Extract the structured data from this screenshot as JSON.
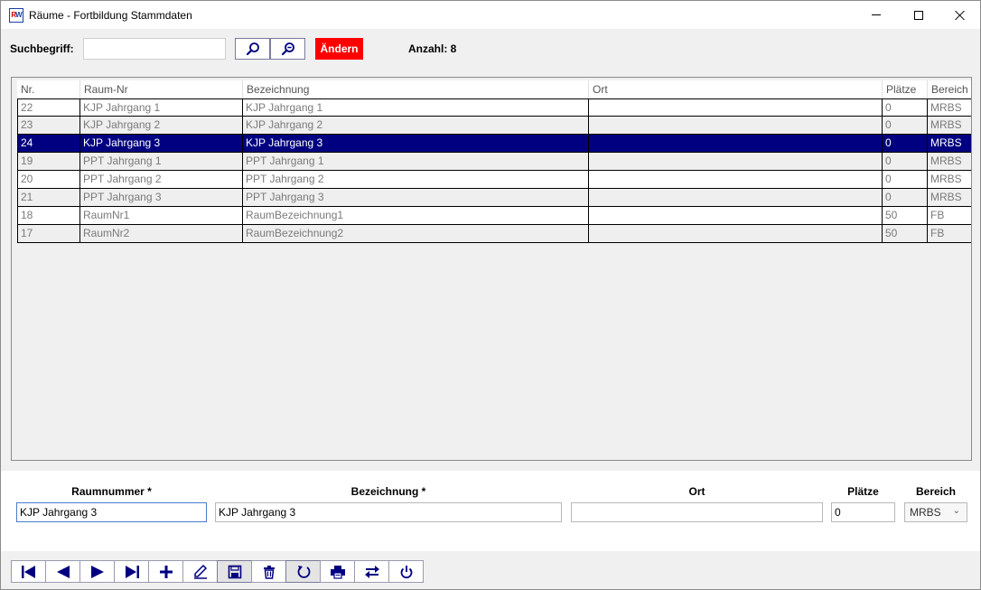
{
  "window": {
    "title": "Räume - Fortbildung Stammdaten",
    "icon_text_left": "R",
    "icon_text_right": "W"
  },
  "search": {
    "label": "Suchbegriff:",
    "value": "",
    "placeholder": ""
  },
  "buttons": {
    "change_label": "Ändern"
  },
  "count_label": "Anzahl: 8",
  "table": {
    "columns": [
      "Nr.",
      "Raum-Nr",
      "Bezeichnung",
      "Ort",
      "Plätze",
      "Bereich"
    ],
    "rows": [
      [
        "22",
        "KJP Jahrgang 1",
        "KJP Jahrgang 1",
        "",
        "0",
        "MRBS"
      ],
      [
        "23",
        "KJP Jahrgang 2",
        "KJP Jahrgang 2",
        "",
        "0",
        "MRBS"
      ],
      [
        "24",
        "KJP Jahrgang 3",
        "KJP Jahrgang 3",
        "",
        "0",
        "MRBS"
      ],
      [
        "19",
        "PPT Jahrgang 1",
        "PPT Jahrgang 1",
        "",
        "0",
        "MRBS"
      ],
      [
        "20",
        "PPT Jahrgang 2",
        "PPT Jahrgang 2",
        "",
        "0",
        "MRBS"
      ],
      [
        "21",
        "PPT Jahrgang 3",
        "PPT Jahrgang 3",
        "",
        "0",
        "MRBS"
      ],
      [
        "18",
        "RaumNr1",
        "RaumBezeichnung1",
        "",
        "50",
        "FB"
      ],
      [
        "17",
        "RaumNr2",
        "RaumBezeichnung2",
        "",
        "50",
        "FB"
      ]
    ],
    "selected_row_index": 2
  },
  "form": {
    "raumnummer_label": "Raumnummer *",
    "raumnummer_value": "KJP Jahrgang 3",
    "bezeichnung_label": "Bezeichnung *",
    "bezeichnung_value": "KJP Jahrgang 3",
    "ort_label": "Ort",
    "ort_value": "",
    "plaetze_label": "Plätze",
    "plaetze_value": "0",
    "bereich_label": "Bereich",
    "bereich_value": "MRBS"
  },
  "nav_icons": [
    "first-record-icon",
    "previous-record-icon",
    "next-record-icon",
    "last-record-icon",
    "add-icon",
    "edit-icon",
    "save-icon",
    "delete-icon",
    "undo-icon",
    "print-icon",
    "refresh-icon",
    "power-icon"
  ],
  "colors": {
    "selection": "#000080",
    "accent": "#ff0000",
    "icon": "#000080"
  }
}
